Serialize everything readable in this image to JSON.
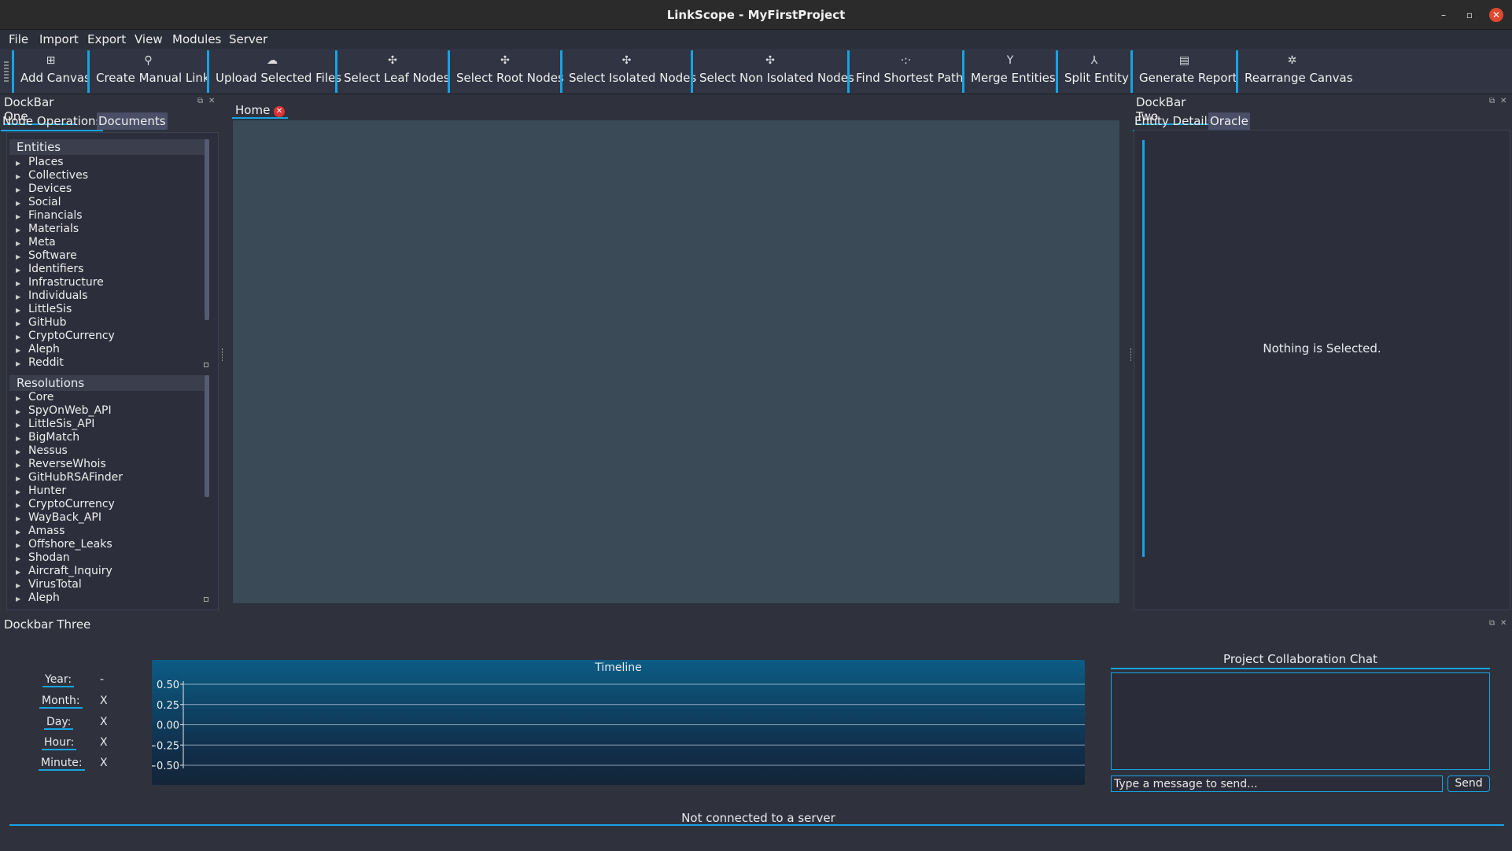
{
  "window": {
    "title": "LinkScope - MyFirstProject",
    "minimize": "–",
    "restore": "▫",
    "close": "✕"
  },
  "menu": [
    "File",
    "Import",
    "Export",
    "View",
    "Modules",
    "Server"
  ],
  "toolbar": [
    {
      "label": "Add Canvas",
      "icon": "add-canvas-icon"
    },
    {
      "label": "Create Manual Link",
      "icon": "link-icon"
    },
    {
      "label": "Upload Selected Files",
      "icon": "upload-icon"
    },
    {
      "label": "Select Leaf Nodes",
      "icon": "leaf-nodes-icon"
    },
    {
      "label": "Select Root Nodes",
      "icon": "root-nodes-icon"
    },
    {
      "label": "Select Isolated Nodes",
      "icon": "isolated-nodes-icon"
    },
    {
      "label": "Select Non Isolated Nodes",
      "icon": "non-isolated-nodes-icon"
    },
    {
      "label": "Find Shortest Path",
      "icon": "path-icon"
    },
    {
      "label": "Merge Entities",
      "icon": "merge-icon"
    },
    {
      "label": "Split Entity",
      "icon": "split-icon"
    },
    {
      "label": "Generate Report",
      "icon": "report-icon"
    },
    {
      "label": "Rearrange Canvas",
      "icon": "rearrange-icon"
    }
  ],
  "dock_one": {
    "title": "DockBar One",
    "tabs": [
      "Node Operations",
      "Documents"
    ],
    "entities_header": "Entities",
    "entities": [
      "Places",
      "Collectives",
      "Devices",
      "Social",
      "Financials",
      "Materials",
      "Meta",
      "Software",
      "Identifiers",
      "Infrastructure",
      "Individuals",
      "LittleSis",
      "GitHub",
      "CryptoCurrency",
      "Aleph",
      "Reddit"
    ],
    "resolutions_header": "Resolutions",
    "resolutions": [
      "Core",
      "SpyOnWeb_API",
      "LittleSis_API",
      "BigMatch",
      "Nessus",
      "ReverseWhois",
      "GitHubRSAFinder",
      "Hunter",
      "CryptoCurrency",
      "WayBack_API",
      "Amass",
      "Offshore_Leaks",
      "Shodan",
      "Aircraft_Inquiry",
      "VirusTotal",
      "Aleph"
    ]
  },
  "canvas": {
    "tab": "Home"
  },
  "dock_two": {
    "title": "DockBar Two",
    "tabs": [
      "Entity Details",
      "Oracle"
    ],
    "empty_text": "Nothing is Selected."
  },
  "dock_three": {
    "title": "Dockbar Three",
    "date_fields": [
      {
        "label": "Year:",
        "value": "-"
      },
      {
        "label": "Month:",
        "value": "X"
      },
      {
        "label": "Day:",
        "value": "X"
      },
      {
        "label": "Hour:",
        "value": "X"
      },
      {
        "label": "Minute:",
        "value": "X"
      }
    ],
    "chat": {
      "title": "Project Collaboration Chat",
      "placeholder": "Type a message to send...",
      "send": "Send"
    }
  },
  "chart_data": {
    "type": "line",
    "title": "Timeline",
    "yticks": [
      "0.50",
      "0.25",
      "0.00",
      "−0.25",
      "−0.50"
    ],
    "ylim": [
      -0.5,
      0.5
    ],
    "series": []
  },
  "status": "Not connected to a server"
}
